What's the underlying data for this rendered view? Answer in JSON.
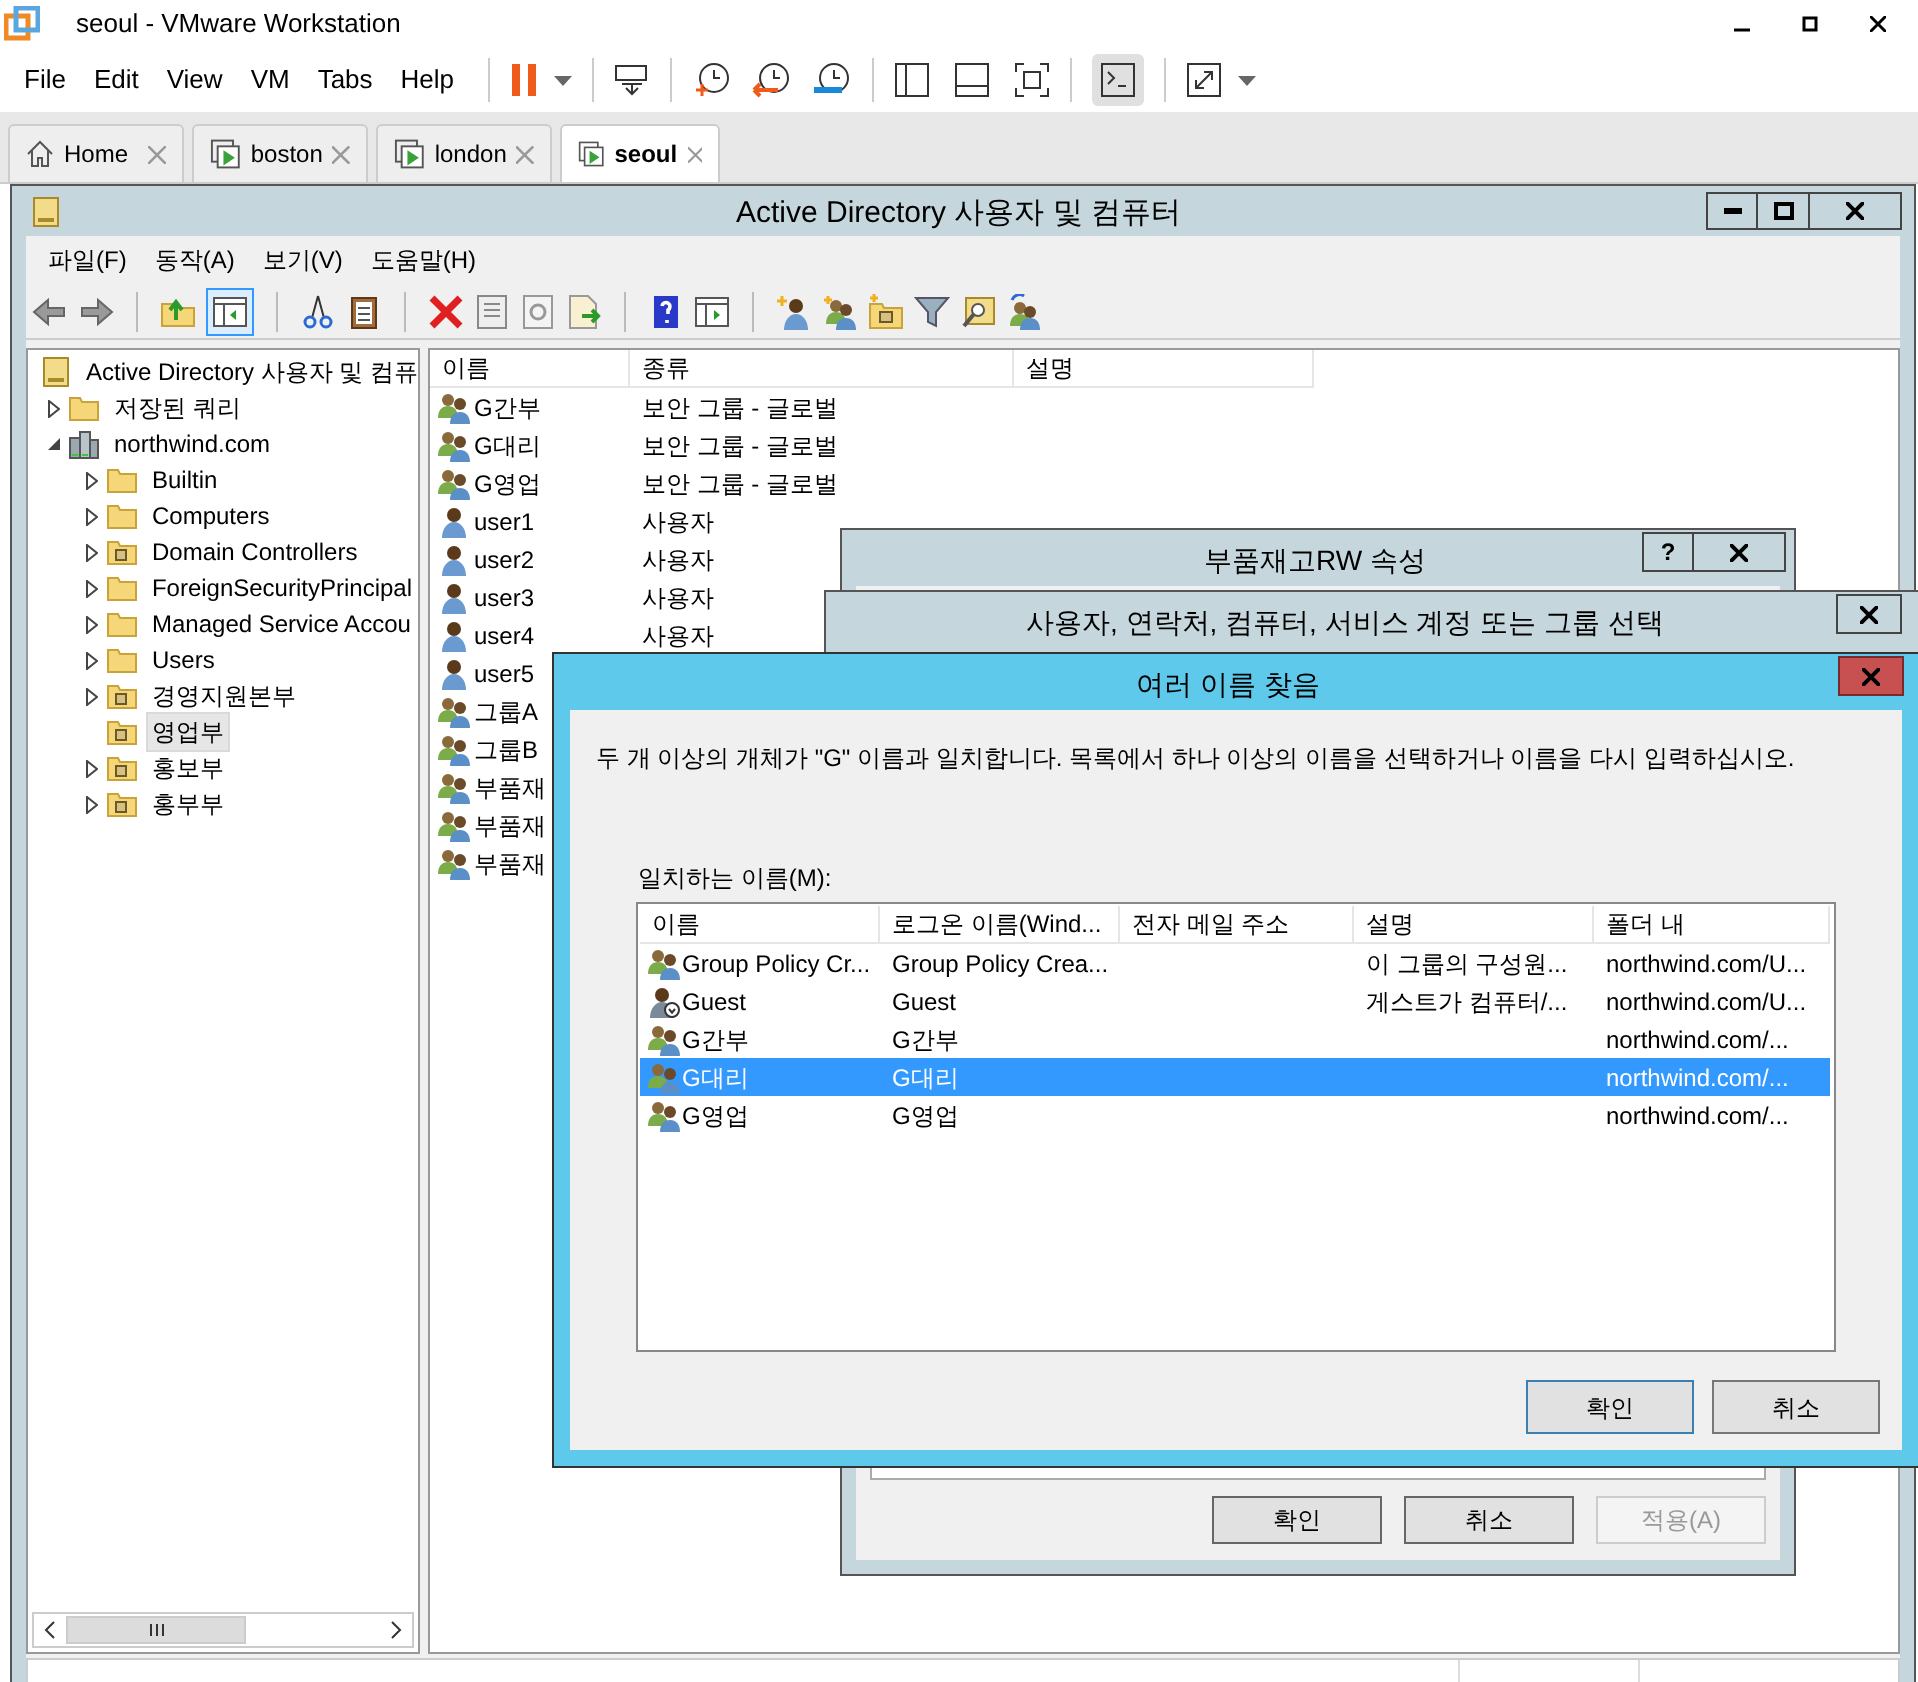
{
  "app": {
    "title": "seoul - VMware Workstation",
    "menu": [
      "File",
      "Edit",
      "View",
      "VM",
      "Tabs",
      "Help"
    ]
  },
  "vm_tabs": [
    {
      "label": "Home",
      "kind": "home",
      "selected": false
    },
    {
      "label": "boston",
      "kind": "vm",
      "selected": false
    },
    {
      "label": "london",
      "kind": "vm",
      "selected": false
    },
    {
      "label": "seoul",
      "kind": "vm",
      "selected": true
    }
  ],
  "ad_window": {
    "title": "Active Directory 사용자 및 컴퓨터",
    "menu": [
      "파일(F)",
      "동작(A)",
      "보기(V)",
      "도움말(H)"
    ],
    "tree": [
      {
        "label": "Active Directory 사용자 및 컴퓨",
        "kind": "root",
        "selected": false,
        "children": [
          {
            "label": "저장된 쿼리",
            "kind": "folder",
            "expanded": false,
            "selected": false
          },
          {
            "label": "northwind.com",
            "kind": "domain",
            "expanded": true,
            "selected": false,
            "children": [
              {
                "label": "Builtin",
                "kind": "folder",
                "expanded": false,
                "selected": false
              },
              {
                "label": "Computers",
                "kind": "folder",
                "expanded": false,
                "selected": false
              },
              {
                "label": "Domain Controllers",
                "kind": "ou",
                "expanded": false,
                "selected": false
              },
              {
                "label": "ForeignSecurityPrincipal",
                "kind": "folder",
                "expanded": false,
                "selected": false
              },
              {
                "label": "Managed Service Accou",
                "kind": "folder",
                "expanded": false,
                "selected": false
              },
              {
                "label": "Users",
                "kind": "folder",
                "expanded": false,
                "selected": false
              },
              {
                "label": "경영지원본부",
                "kind": "ou",
                "expanded": false,
                "selected": false
              },
              {
                "label": "영업부",
                "kind": "ou",
                "selected": true
              },
              {
                "label": "홍보부",
                "kind": "ou",
                "expanded": false,
                "selected": false
              },
              {
                "label": "홍부부",
                "kind": "ou",
                "expanded": false,
                "selected": false
              }
            ]
          }
        ]
      }
    ],
    "list": {
      "columns": [
        "이름",
        "종류",
        "설명"
      ],
      "rows": [
        {
          "kind": "group",
          "name": "G간부",
          "type": "보안 그룹 - 글로벌"
        },
        {
          "kind": "group",
          "name": "G대리",
          "type": "보안 그룹 - 글로벌"
        },
        {
          "kind": "group",
          "name": "G영업",
          "type": "보안 그룹 - 글로벌"
        },
        {
          "kind": "user",
          "name": "user1",
          "type": "사용자"
        },
        {
          "kind": "user",
          "name": "user2",
          "type": "사용자"
        },
        {
          "kind": "user",
          "name": "user3",
          "type": "사용자"
        },
        {
          "kind": "user",
          "name": "user4",
          "type": "사용자"
        },
        {
          "kind": "user",
          "name": "user5"
        },
        {
          "kind": "group",
          "name": "그룹A"
        },
        {
          "kind": "group",
          "name": "그룹B"
        },
        {
          "kind": "group",
          "name": "부품재"
        },
        {
          "kind": "group",
          "name": "부품재"
        },
        {
          "kind": "group",
          "name": "부품재"
        }
      ]
    }
  },
  "properties_dialog": {
    "title": "부품재고RW 속성",
    "title_buttons": [
      "?"
    ],
    "buttons": [
      {
        "label": "확인",
        "disabled": false
      },
      {
        "label": "취소",
        "disabled": false
      },
      {
        "label": "적용(A)",
        "disabled": true
      }
    ]
  },
  "select_dialog": {
    "title": "사용자, 연락처, 컴퓨터, 서비스 계정 또는 그룹 선택"
  },
  "find_dialog": {
    "title": "여러 이름 찾음",
    "message": "두 개 이상의 개체가 \"G\" 이름과 일치합니다. 목록에서 하나 이상의 이름을 선택하거나 이름을 다시 입력하십시오.",
    "list_label": "일치하는 이름(M):",
    "columns": [
      "이름",
      "로그온 이름(Wind...",
      "전자 메일 주소",
      "설명",
      "폴더 내"
    ],
    "rows": [
      {
        "kind": "group",
        "selected": false,
        "cells": [
          "Group Policy Cr...",
          "Group Policy Crea...",
          "",
          "이 그룹의 구성원...",
          "northwind.com/U..."
        ]
      },
      {
        "kind": "disabled_user",
        "selected": false,
        "cells": [
          "Guest",
          "Guest",
          "",
          "게스트가 컴퓨터/...",
          "northwind.com/U..."
        ]
      },
      {
        "kind": "group",
        "selected": false,
        "cells": [
          "G간부",
          "G간부",
          "",
          "",
          "northwind.com/..."
        ]
      },
      {
        "kind": "group",
        "selected": true,
        "cells": [
          "G대리",
          "G대리",
          "",
          "",
          "northwind.com/..."
        ]
      },
      {
        "kind": "group",
        "selected": false,
        "cells": [
          "G영업",
          "G영업",
          "",
          "",
          "northwind.com/..."
        ]
      }
    ],
    "buttons": [
      {
        "label": "확인",
        "default": true
      },
      {
        "label": "취소",
        "default": false
      }
    ]
  }
}
